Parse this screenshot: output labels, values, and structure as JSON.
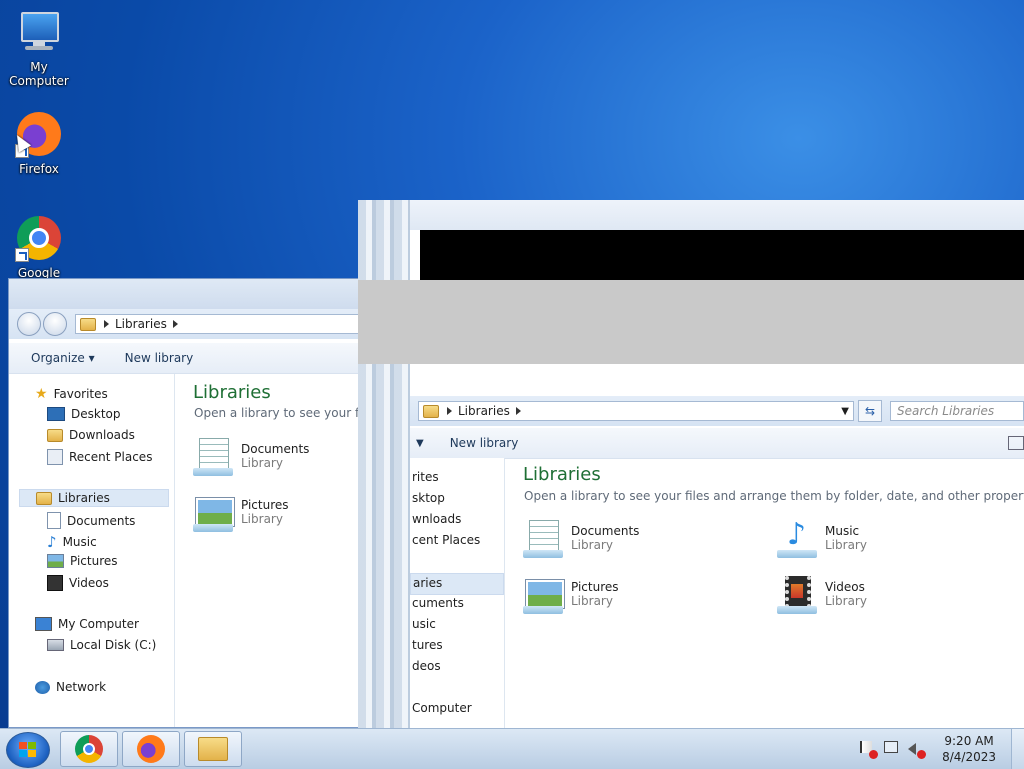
{
  "desktop": {
    "icons": [
      {
        "label": "My Computer"
      },
      {
        "label": "Firefox"
      },
      {
        "label": "Google"
      }
    ]
  },
  "explorer_left": {
    "address": {
      "crumb": "Libraries"
    },
    "toolbar": {
      "organize": "Organize",
      "new_library": "New library"
    },
    "nav": {
      "favorites": "Favorites",
      "desktop": "Desktop",
      "downloads": "Downloads",
      "recent": "Recent Places",
      "libraries": "Libraries",
      "documents": "Documents",
      "music": "Music",
      "pictures": "Pictures",
      "videos": "Videos",
      "computer": "My Computer",
      "localdisk": "Local Disk (C:)",
      "network": "Network"
    },
    "content": {
      "title": "Libraries",
      "subtitle": "Open a library to see your files",
      "items": [
        {
          "name": "Documents",
          "type": "Library"
        },
        {
          "name": "Pictures",
          "type": "Library"
        }
      ]
    }
  },
  "explorer_right": {
    "address": {
      "crumb": "Libraries",
      "search_placeholder": "Search Libraries"
    },
    "toolbar": {
      "new_library": "New library"
    },
    "nav_fragments": [
      "rites",
      "sktop",
      "wnloads",
      "cent Places",
      "aries",
      "cuments",
      "usic",
      "tures",
      "deos",
      "Computer"
    ],
    "content": {
      "title": "Libraries",
      "subtitle": "Open a library to see your files and arrange them by folder, date, and other properties.",
      "items": [
        {
          "name": "Documents",
          "type": "Library"
        },
        {
          "name": "Music",
          "type": "Library"
        },
        {
          "name": "Pictures",
          "type": "Library"
        },
        {
          "name": "Videos",
          "type": "Library"
        }
      ]
    }
  },
  "taskbar": {
    "time": "9:20 AM",
    "date": "8/4/2023"
  }
}
